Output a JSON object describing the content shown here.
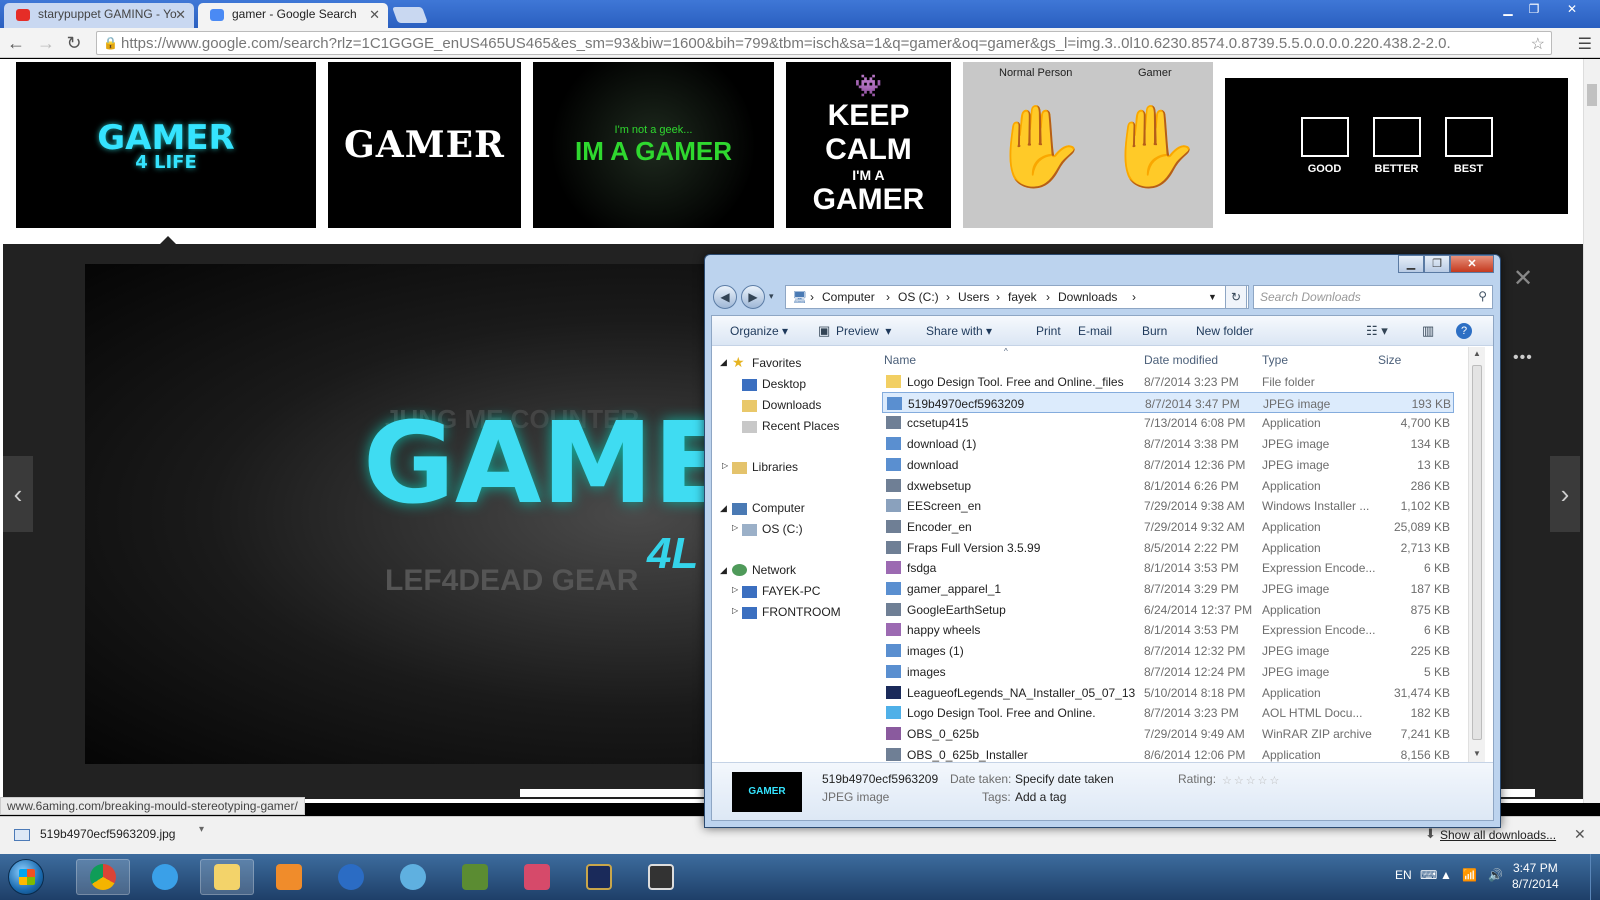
{
  "browser": {
    "tabs": [
      {
        "label": "starypuppet GAMING - Yo",
        "active": false
      },
      {
        "label": "gamer - Google Search",
        "active": true
      }
    ],
    "url": "https://www.google.com/search?rlz=1C1GGGE_enUS465US465&es_sm=93&biw=1600&bih=799&tbm=isch&sa=1&q=gamer&oq=gamer&gs_l=img.3..0l10.6230.8574.0.8739.5.5.0.0.0.0.220.438.2-2.0.",
    "status_url": "www.6aming.com/breaking-mould-stereotyping-gamer/"
  },
  "thumbnails": {
    "t1_main": "GAMER",
    "t1_sub": "4 LIFE",
    "t2_main": "GAMER",
    "t3_top": "I'm not a geek...",
    "t3_main": "IM A GAMER",
    "t4_l1": "KEEP",
    "t4_l2": "CALM",
    "t4_l3": "I'M A",
    "t4_l4": "GAMER",
    "t5_left": "Normal Person",
    "t5_right": "Gamer",
    "t6_labels": [
      "GOOD",
      "BETTER",
      "BEST"
    ]
  },
  "preview": {
    "word": "GAME",
    "sub": "4L",
    "bg1": "LEF4DEAD  GEAR",
    "bg2": "JUNG  ME  COUNTER"
  },
  "explorer": {
    "breadcrumb": [
      "Computer",
      "OS (C:)",
      "Users",
      "fayek",
      "Downloads"
    ],
    "search_placeholder": "Search Downloads",
    "commands": {
      "organize": "Organize",
      "preview": "Preview",
      "share": "Share with",
      "print": "Print",
      "email": "E-mail",
      "burn": "Burn",
      "new_folder": "New folder"
    },
    "tree": {
      "favorites": "Favorites",
      "desktop": "Desktop",
      "downloads": "Downloads",
      "recent": "Recent Places",
      "libraries": "Libraries",
      "computer": "Computer",
      "os_c": "OS (C:)",
      "network": "Network",
      "fayek_pc": "FAYEK-PC",
      "frontroom": "FRONTROOM"
    },
    "columns": {
      "name": "Name",
      "date": "Date modified",
      "type": "Type",
      "size": "Size"
    },
    "files": [
      {
        "name": "Logo Design Tool. Free and Online._files",
        "date": "8/7/2014 3:23 PM",
        "type": "File folder",
        "size": "",
        "icon": "folder",
        "selected": false
      },
      {
        "name": "519b4970ecf5963209",
        "date": "8/7/2014 3:47 PM",
        "type": "JPEG image",
        "size": "193 KB",
        "icon": "image",
        "selected": true
      },
      {
        "name": "ccsetup415",
        "date": "7/13/2014 6:08 PM",
        "type": "Application",
        "size": "4,700 KB",
        "icon": "app",
        "selected": false
      },
      {
        "name": "download (1)",
        "date": "8/7/2014 3:38 PM",
        "type": "JPEG image",
        "size": "134 KB",
        "icon": "image",
        "selected": false
      },
      {
        "name": "download",
        "date": "8/7/2014 12:36 PM",
        "type": "JPEG image",
        "size": "13 KB",
        "icon": "image",
        "selected": false
      },
      {
        "name": "dxwebsetup",
        "date": "8/1/2014 6:26 PM",
        "type": "Application",
        "size": "286 KB",
        "icon": "app",
        "selected": false
      },
      {
        "name": "EEScreen_en",
        "date": "7/29/2014 9:38 AM",
        "type": "Windows Installer ...",
        "size": "1,102 KB",
        "icon": "installer",
        "selected": false
      },
      {
        "name": "Encoder_en",
        "date": "7/29/2014 9:32 AM",
        "type": "Application",
        "size": "25,089 KB",
        "icon": "app",
        "selected": false
      },
      {
        "name": "Fraps Full Version 3.5.99",
        "date": "8/5/2014 2:22 PM",
        "type": "Application",
        "size": "2,713 KB",
        "icon": "app",
        "selected": false
      },
      {
        "name": "fsdga",
        "date": "8/1/2014 3:53 PM",
        "type": "Expression Encode...",
        "size": "6 KB",
        "icon": "expression",
        "selected": false
      },
      {
        "name": "gamer_apparel_1",
        "date": "8/7/2014 3:29 PM",
        "type": "JPEG image",
        "size": "187 KB",
        "icon": "image",
        "selected": false
      },
      {
        "name": "GoogleEarthSetup",
        "date": "6/24/2014 12:37 PM",
        "type": "Application",
        "size": "875 KB",
        "icon": "app",
        "selected": false
      },
      {
        "name": "happy wheels",
        "date": "8/1/2014 3:53 PM",
        "type": "Expression Encode...",
        "size": "6 KB",
        "icon": "expression",
        "selected": false
      },
      {
        "name": "images (1)",
        "date": "8/7/2014 12:32 PM",
        "type": "JPEG image",
        "size": "225 KB",
        "icon": "image",
        "selected": false
      },
      {
        "name": "images",
        "date": "8/7/2014 12:24 PM",
        "type": "JPEG image",
        "size": "5 KB",
        "icon": "image",
        "selected": false
      },
      {
        "name": "LeagueofLegends_NA_Installer_05_07_13",
        "date": "5/10/2014 8:18 PM",
        "type": "Application",
        "size": "31,474 KB",
        "icon": "lol",
        "selected": false
      },
      {
        "name": "Logo Design Tool. Free and Online.",
        "date": "8/7/2014 3:23 PM",
        "type": "AOL HTML Docu...",
        "size": "182 KB",
        "icon": "html",
        "selected": false
      },
      {
        "name": "OBS_0_625b",
        "date": "7/29/2014 9:49 AM",
        "type": "WinRAR ZIP archive",
        "size": "7,241 KB",
        "icon": "zip",
        "selected": false
      },
      {
        "name": "OBS_0_625b_Installer",
        "date": "8/6/2014 12:06 PM",
        "type": "Application",
        "size": "8,156 KB",
        "icon": "app",
        "selected": false
      }
    ],
    "details": {
      "thumb_text": "GAMER",
      "filename": "519b4970ecf5963209",
      "filetype": "JPEG image",
      "date_label": "Date taken:",
      "date_value": "Specify date taken",
      "tags_label": "Tags:",
      "tags_value": "Add a tag",
      "rating_label": "Rating:"
    }
  },
  "downloads": {
    "file": "519b4970ecf5963209.jpg",
    "show_all": "Show all downloads..."
  },
  "taskbar": {
    "lang": "EN",
    "time": "3:47 PM",
    "date": "8/7/2014"
  },
  "colors": {
    "chrome_blue": "#3f77d6",
    "selection": "#dcebfc",
    "taskbar": "#2a5080",
    "gamer_cyan": "#3fdcf2"
  }
}
